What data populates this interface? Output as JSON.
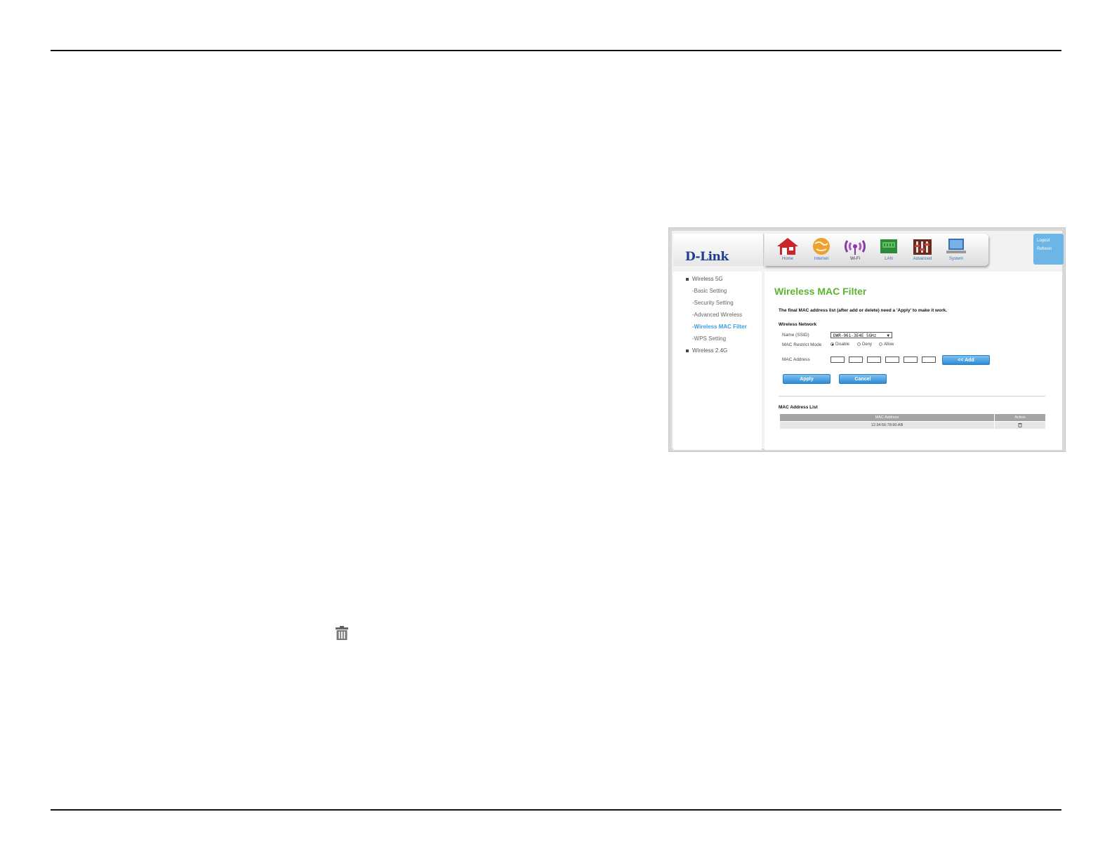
{
  "logo": {
    "brand": "D-Link"
  },
  "nav": [
    {
      "label": "Home",
      "icon": "home-icon"
    },
    {
      "label": "Internet",
      "icon": "globe-icon"
    },
    {
      "label": "Wi-Fi",
      "icon": "wifi-icon"
    },
    {
      "label": "LAN",
      "icon": "lan-icon"
    },
    {
      "label": "Advanced",
      "icon": "advanced-icon"
    },
    {
      "label": "System",
      "icon": "system-icon"
    }
  ],
  "top_links": {
    "logout": "Logout",
    "refresh": "Refresh"
  },
  "sidebar": {
    "groups": [
      {
        "label": "Wireless 5G",
        "items": [
          "-Basic Setting",
          "-Security Setting",
          "-Advanced Wireless",
          "-Wireless MAC Filter",
          "-WPS Setting"
        ]
      },
      {
        "label": "Wireless 2.4G",
        "items": []
      }
    ],
    "active_item": "-Wireless MAC Filter"
  },
  "content": {
    "title": "Wireless MAC Filter",
    "notice": "The final MAC address list (after add or delete) need a 'Apply' to make it work.",
    "section_title": "Wireless Network",
    "ssid_label": "Name  (SSID)",
    "ssid_value": "DWR-961-3E4E_5GHz",
    "restrict_label": "MAC Restrict Mode",
    "restrict_options": [
      "Disable",
      "Deny",
      "Allow"
    ],
    "restrict_selected": "Disable",
    "mac_label": "MAC Address",
    "mac_separator": ":",
    "add_button": "<< Add",
    "apply_button": "Apply",
    "cancel_button": "Cancel",
    "list_title": "MAC Address List",
    "table": {
      "headers": [
        "MAC Address",
        "Action"
      ],
      "rows": [
        {
          "mac": "12:34:56:78:90:AB"
        }
      ]
    }
  },
  "colors": {
    "title_green": "#5cb531",
    "active_blue": "#3aa0e0",
    "button_blue": "#2d8bd6",
    "logo_blue": "#1c3d8f"
  }
}
